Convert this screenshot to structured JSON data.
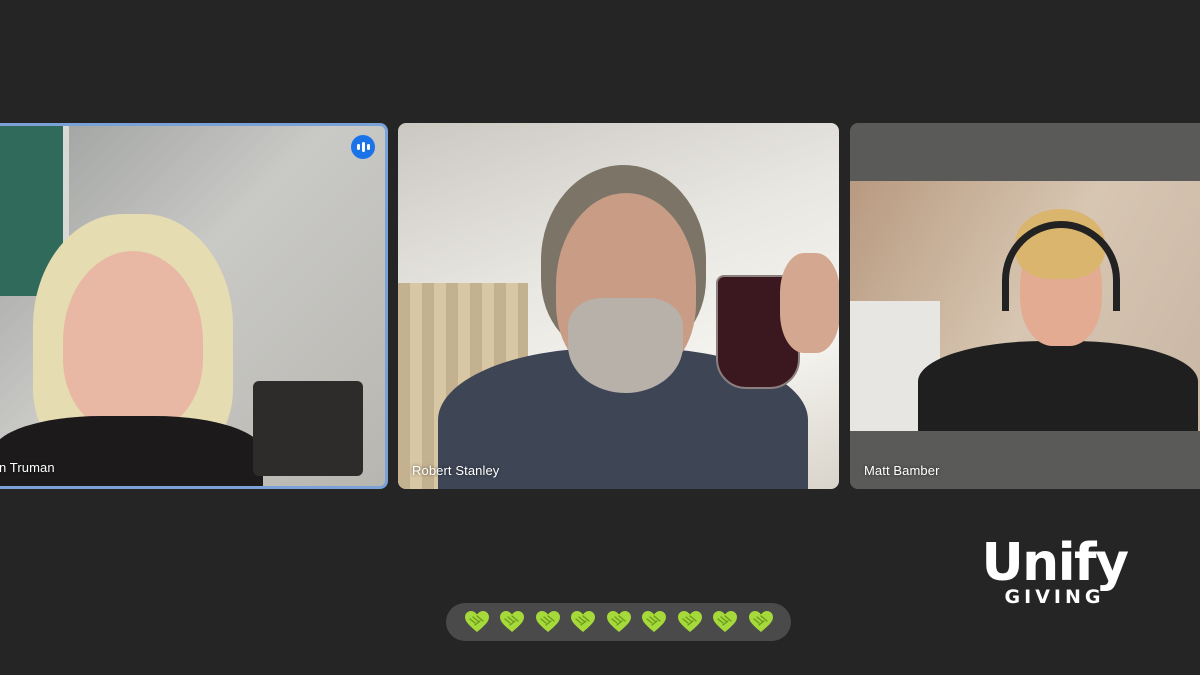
{
  "participants": [
    {
      "name": "n Truman",
      "speaking": true,
      "icon": "audio-wave-icon"
    },
    {
      "name": "Robert Stanley",
      "speaking": false
    },
    {
      "name": "Matt Bamber",
      "speaking": false
    }
  ],
  "reactions": {
    "emoji": "green-heart-handshake-icon",
    "count": 9,
    "color": "#a6d93a"
  },
  "logo": {
    "main": "Unify",
    "sub": "GIVING"
  },
  "colors": {
    "background": "#252525",
    "active_border": "#7aa2d8",
    "speaking_badge": "#1a73e8",
    "reaction_bar": "#4a4a4a"
  }
}
